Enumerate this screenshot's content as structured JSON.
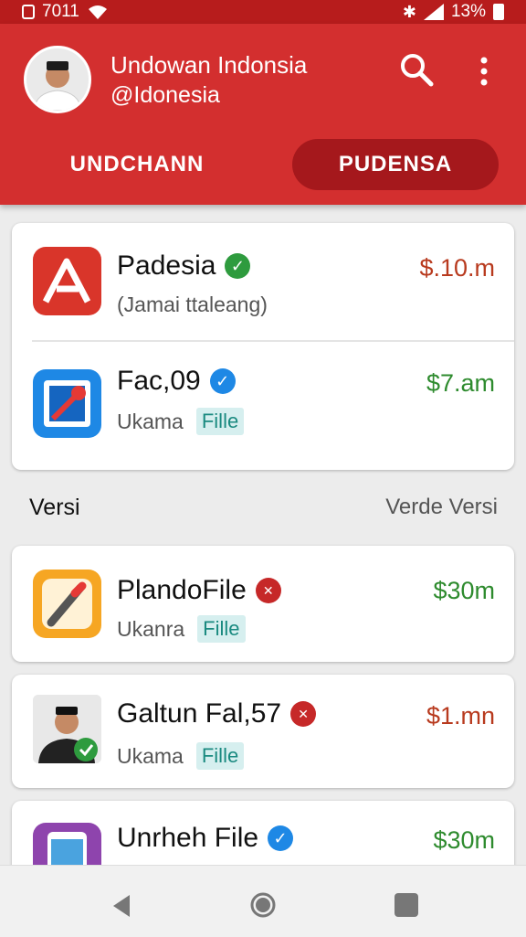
{
  "status": {
    "left_text": "7011",
    "battery_text": "13%"
  },
  "header": {
    "account_name": "Undowan Indonsia",
    "account_handle": "@Idonesia",
    "tabs": [
      {
        "label": "UNDCHANN"
      },
      {
        "label": "PUDENSA"
      }
    ]
  },
  "apps_top": [
    {
      "name": "Padesia",
      "sub": "(Jamai ttaleang)",
      "tag": "",
      "price": "$.10.m",
      "price_color": "#b83a1e",
      "badge": "green-check",
      "icon": "red-a-icon"
    },
    {
      "name": "Fac,09",
      "sub": "Ukama",
      "tag": "Fille",
      "price": "$7.am",
      "price_color": "#2e8b2e",
      "badge": "blue-check",
      "icon": "blue-pin-icon"
    }
  ],
  "section": {
    "title": "Versi",
    "link": "Verde Versi"
  },
  "apps_bottom": [
    {
      "name": "PlandoFile",
      "sub": "Ukanra",
      "tag": "Fille",
      "price": "$30m",
      "price_color": "#2e8b2e",
      "badge": "red-dot",
      "icon": "pen-icon"
    },
    {
      "name": "Galtun Fal,57",
      "sub": "Ukama",
      "tag": "Fille",
      "price": "$1.mn",
      "price_color": "#b83a1e",
      "badge": "red-dot",
      "icon": "person-photo-icon"
    },
    {
      "name": "Unrheh File",
      "sub": "",
      "tag": "",
      "price": "$30m",
      "price_color": "#2e8b2e",
      "badge": "blue-check",
      "icon": "purple-phone-icon"
    }
  ],
  "colors": {
    "header": "#d32f2f",
    "status_bar": "#b71c1c",
    "active_tab": "#a5181c",
    "green_price": "#2e8b2e",
    "red_price": "#b83a1e"
  }
}
